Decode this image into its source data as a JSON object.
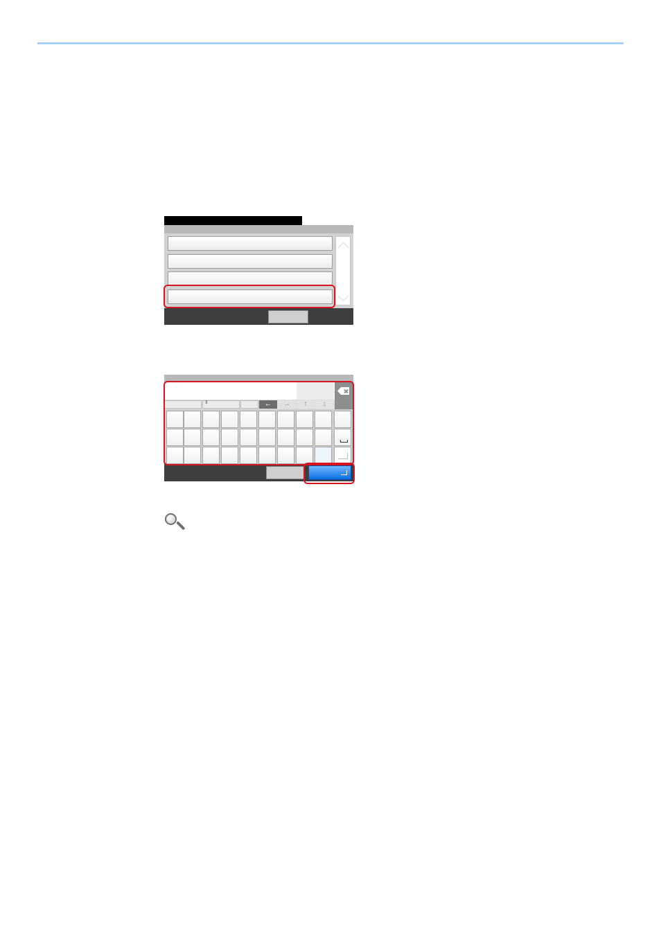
{
  "header": {
    "accent": "#a9d0f5"
  },
  "screen_list": {
    "item_count": 4,
    "selected_index": 3
  },
  "screen_keyboard": {
    "backspace_icon": "backspace-icon",
    "arrows": {
      "left": "←",
      "right": "→",
      "up": "↑",
      "down": "↓"
    },
    "updown_icon": "⇕",
    "rows": 3,
    "cols": 10,
    "space_icon": "space-icon",
    "enter_icon": "enter-icon",
    "ok_color": "#0a6ee0"
  },
  "highlight_color": "#d7141f",
  "note": {
    "icon": "magnifier-icon"
  }
}
